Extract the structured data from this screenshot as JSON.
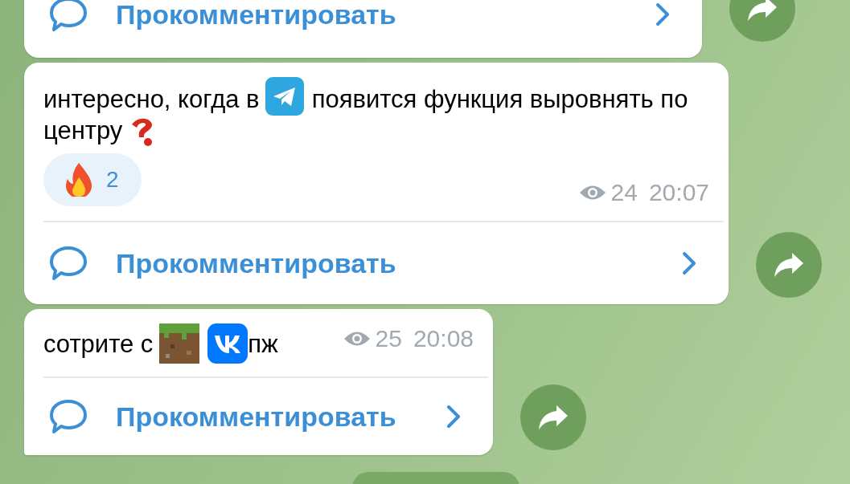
{
  "messages": [
    {
      "comment_label": "Прокомментировать"
    },
    {
      "parts": [
        {
          "kind": "text",
          "text": "интересно, когда в"
        },
        {
          "kind": "telegram-logo"
        },
        {
          "kind": "text",
          "text": "появится функция выровнять по"
        },
        {
          "kind": "text",
          "text": "центру"
        },
        {
          "kind": "question-emoji"
        }
      ],
      "reactions": [
        {
          "kind": "fire",
          "count": "2",
          "selected": false
        }
      ],
      "views": "24",
      "time": "20:07",
      "comment_label": "Прокомментировать"
    },
    {
      "parts": [
        {
          "kind": "text",
          "text": "сотрите с"
        },
        {
          "kind": "grass-block"
        },
        {
          "kind": "vk-logo"
        },
        {
          "kind": "text",
          "text": "пж"
        }
      ],
      "views": "25",
      "time": "20:08",
      "comment_label": "Прокомментировать"
    }
  ]
}
